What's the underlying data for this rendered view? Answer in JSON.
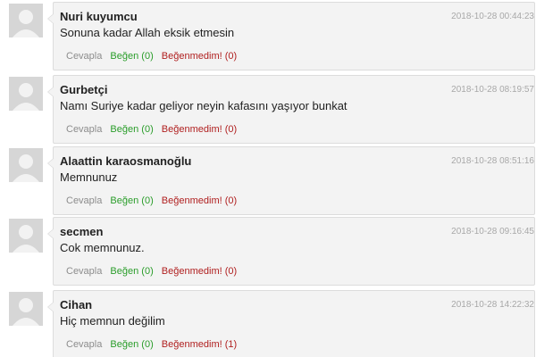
{
  "comments": [
    {
      "author": "Nuri kuyumcu",
      "timestamp": "2018-10-28 00:44:23",
      "text": "Sonuna kadar Allah eksik etmesin",
      "reply_label": "Cevapla",
      "like_label": "Beğen (0)",
      "dislike_label": "Beğenmedim! (0)"
    },
    {
      "author": "Gurbetçi",
      "timestamp": "2018-10-28 08:19:57",
      "text": "Namı Suriye kadar geliyor neyin kafasını yaşıyor bunkat",
      "reply_label": "Cevapla",
      "like_label": "Beğen (0)",
      "dislike_label": "Beğenmedim! (0)"
    },
    {
      "author": "Alaattin karaosmanoğlu",
      "timestamp": "2018-10-28 08:51:16",
      "text": "Memnunuz",
      "reply_label": "Cevapla",
      "like_label": "Beğen (0)",
      "dislike_label": "Beğenmedim! (0)"
    },
    {
      "author": "secmen",
      "timestamp": "2018-10-28 09:16:45",
      "text": "Cok memnunuz.",
      "reply_label": "Cevapla",
      "like_label": "Beğen (0)",
      "dislike_label": "Beğenmedim! (0)"
    },
    {
      "author": "Cihan",
      "timestamp": "2018-10-28 14:22:32",
      "text": "Hiç memnun değilim",
      "reply_label": "Cevapla",
      "like_label": "Beğen (0)",
      "dislike_label": "Beğenmedim! (1)"
    }
  ]
}
